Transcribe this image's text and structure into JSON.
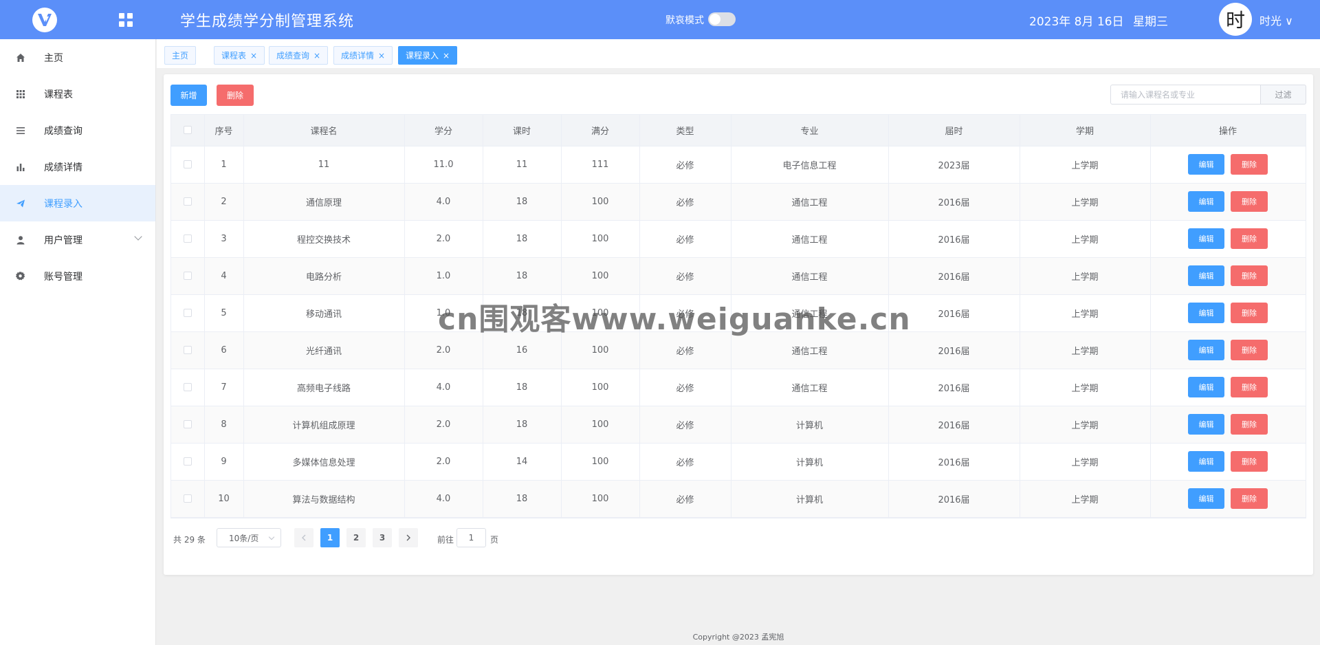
{
  "header": {
    "title": "学生成绩学分制管理系统",
    "gray_mode_label": "默哀模式",
    "date": "2023年 8月 16日",
    "weekday": "星期三",
    "avatar_char": "时",
    "user_name": "时光 ∨",
    "colors": {
      "bar": "#5b8ff9"
    }
  },
  "sidebar": {
    "items": [
      {
        "label": "主页",
        "icon": "home-icon"
      },
      {
        "label": "课程表",
        "icon": "grid-icon"
      },
      {
        "label": "成绩查询",
        "icon": "list-icon"
      },
      {
        "label": "成绩详情",
        "icon": "bar-chart-icon"
      },
      {
        "label": "课程录入",
        "icon": "send-icon",
        "active": true
      },
      {
        "label": "用户管理",
        "icon": "user-icon",
        "has_submenu": true
      },
      {
        "label": "账号管理",
        "icon": "gear-icon"
      }
    ]
  },
  "tabs": [
    {
      "label": "主页",
      "closable": false
    },
    {
      "label": "课程表",
      "closable": true
    },
    {
      "label": "成绩查询",
      "closable": true
    },
    {
      "label": "成绩详情",
      "closable": true
    },
    {
      "label": "课程录入",
      "closable": true,
      "active": true
    }
  ],
  "toolbar": {
    "add_label": "新增",
    "delete_label": "删除",
    "search_placeholder": "请输入课程名或专业",
    "search_value": "",
    "filter_label": "过滤"
  },
  "table": {
    "columns": [
      "序号",
      "课程名",
      "学分",
      "课时",
      "满分",
      "类型",
      "专业",
      "届时",
      "学期",
      "操作"
    ],
    "edit_label": "编辑",
    "delete_label": "删除",
    "rows": [
      [
        "1",
        "11",
        "11.0",
        "11",
        "111",
        "必修",
        "电子信息工程",
        "2023届",
        "上学期"
      ],
      [
        "2",
        "通信原理",
        "4.0",
        "18",
        "100",
        "必修",
        "通信工程",
        "2016届",
        "上学期"
      ],
      [
        "3",
        "程控交换技术",
        "2.0",
        "18",
        "100",
        "必修",
        "通信工程",
        "2016届",
        "上学期"
      ],
      [
        "4",
        "电路分析",
        "1.0",
        "18",
        "100",
        "必修",
        "通信工程",
        "2016届",
        "上学期"
      ],
      [
        "5",
        "移动通讯",
        "1.0",
        "18",
        "100",
        "必修",
        "通信工程",
        "2016届",
        "上学期"
      ],
      [
        "6",
        "光纤通讯",
        "2.0",
        "16",
        "100",
        "必修",
        "通信工程",
        "2016届",
        "上学期"
      ],
      [
        "7",
        "高频电子线路",
        "4.0",
        "18",
        "100",
        "必修",
        "通信工程",
        "2016届",
        "上学期"
      ],
      [
        "8",
        "计算机组成原理",
        "2.0",
        "18",
        "100",
        "必修",
        "计算机",
        "2016届",
        "上学期"
      ],
      [
        "9",
        "多媒体信息处理",
        "2.0",
        "14",
        "100",
        "必修",
        "计算机",
        "2016届",
        "上学期"
      ],
      [
        "10",
        "算法与数据结构",
        "4.0",
        "18",
        "100",
        "必修",
        "计算机",
        "2016届",
        "上学期"
      ]
    ]
  },
  "pagination": {
    "total_text": "共 29 条",
    "page_size": "10条/页",
    "pages": [
      "1",
      "2",
      "3"
    ],
    "current_page": "1",
    "jump_label": "前往",
    "jump_value": "1",
    "jump_suffix": "页"
  },
  "footer": {
    "copyright": "Copyright @2023 孟宪旭"
  },
  "watermark": "cn围观客www.weiguanke.cn"
}
